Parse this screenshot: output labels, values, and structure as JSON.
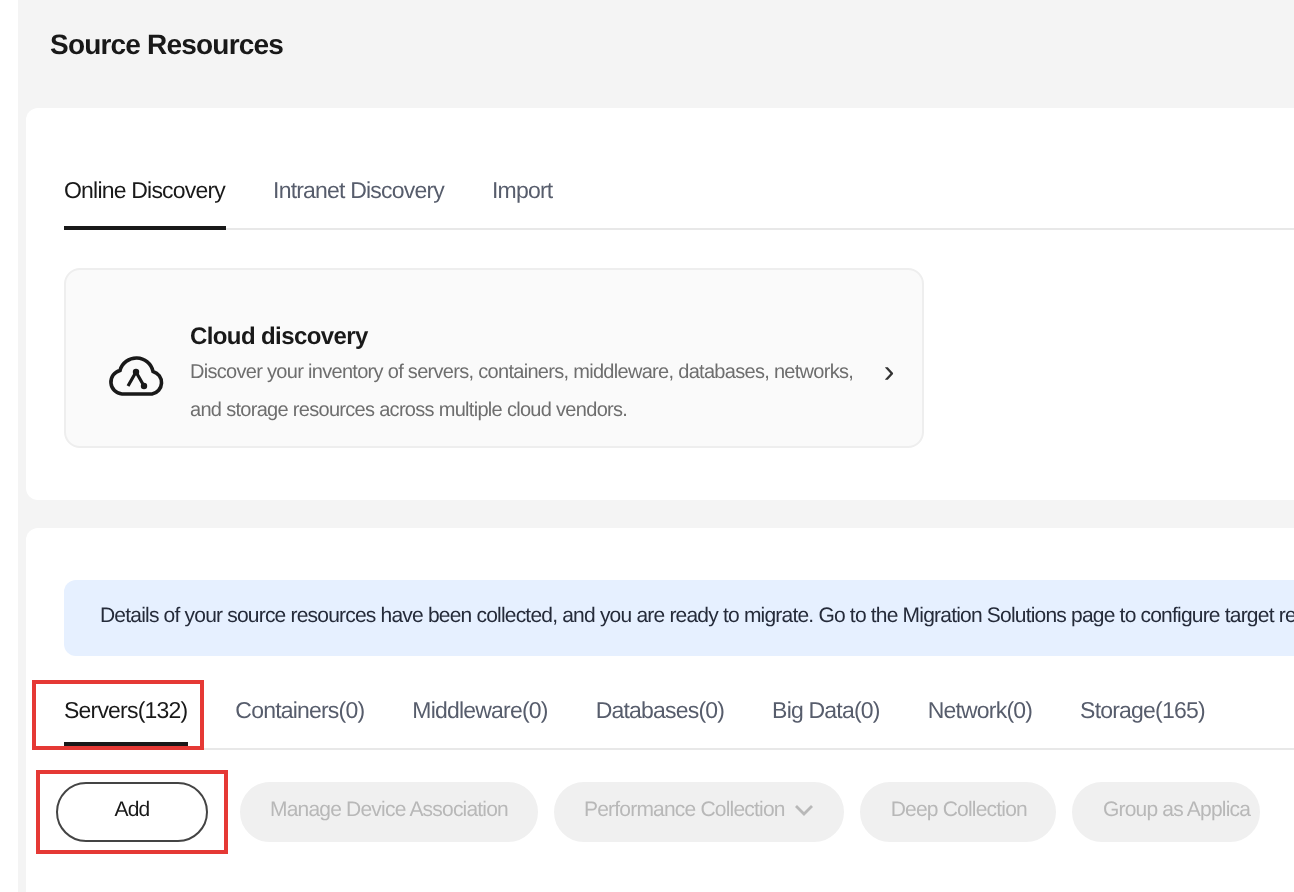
{
  "page_title": "Source Resources",
  "discovery_tabs": [
    {
      "label": "Online Discovery",
      "selected": true
    },
    {
      "label": "Intranet Discovery",
      "selected": false
    },
    {
      "label": "Import",
      "selected": false
    }
  ],
  "discovery_card": {
    "title": "Cloud discovery",
    "description": "Discover your inventory of servers, containers, middleware, databases, networks, and storage resources across multiple cloud vendors.",
    "chevron": "›"
  },
  "info_banner": "Details of your source resources have been collected, and you are ready to migrate. Go to the Migration Solutions page to configure target re",
  "resource_tabs": [
    {
      "label": "Servers(132)",
      "selected": true,
      "highlighted": true
    },
    {
      "label": "Containers(0)",
      "selected": false,
      "highlighted": false
    },
    {
      "label": "Middleware(0)",
      "selected": false,
      "highlighted": false
    },
    {
      "label": "Databases(0)",
      "selected": false,
      "highlighted": false
    },
    {
      "label": "Big Data(0)",
      "selected": false,
      "highlighted": false
    },
    {
      "label": "Network(0)",
      "selected": false,
      "highlighted": false
    },
    {
      "label": "Storage(165)",
      "selected": false,
      "highlighted": false
    }
  ],
  "actions": [
    {
      "label": "Add",
      "disabled": false,
      "highlighted": true,
      "dropdown": false
    },
    {
      "label": "Manage Device Association",
      "disabled": true,
      "highlighted": false,
      "dropdown": false
    },
    {
      "label": "Performance Collection",
      "disabled": true,
      "highlighted": false,
      "dropdown": true
    },
    {
      "label": "Deep Collection",
      "disabled": true,
      "highlighted": false,
      "dropdown": false
    },
    {
      "label": "Group as Applica",
      "disabled": true,
      "highlighted": false,
      "dropdown": false
    }
  ]
}
